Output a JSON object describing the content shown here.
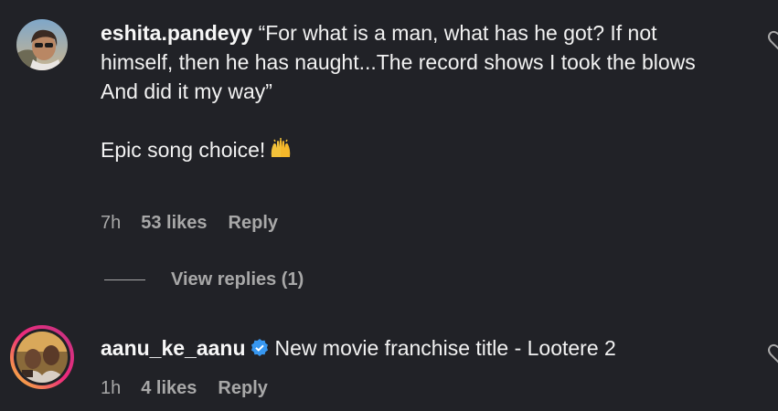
{
  "comments": [
    {
      "username": "eshita.pandeyy",
      "text": "“For what is a man, what has he got? If not himself, then he has naught...The record shows I took the blows\nAnd did it my way”\n\nEpic song choice!",
      "emoji": "raising-hands",
      "time": "7h",
      "likes": "53 likes",
      "reply_label": "Reply",
      "view_replies_label": "View replies (1)"
    },
    {
      "username": "aanu_ke_aanu",
      "verified": true,
      "text": "New movie franchise title - Lootere 2",
      "time": "1h",
      "likes": "4 likes",
      "reply_label": "Reply"
    }
  ],
  "colors": {
    "background": "#212227",
    "primary_text": "#f2f2f2",
    "secondary_text": "#a8a8a8",
    "verified_badge": "#3797f0",
    "story_ring_start": "#f9ce34",
    "story_ring_end": "#c13584"
  }
}
